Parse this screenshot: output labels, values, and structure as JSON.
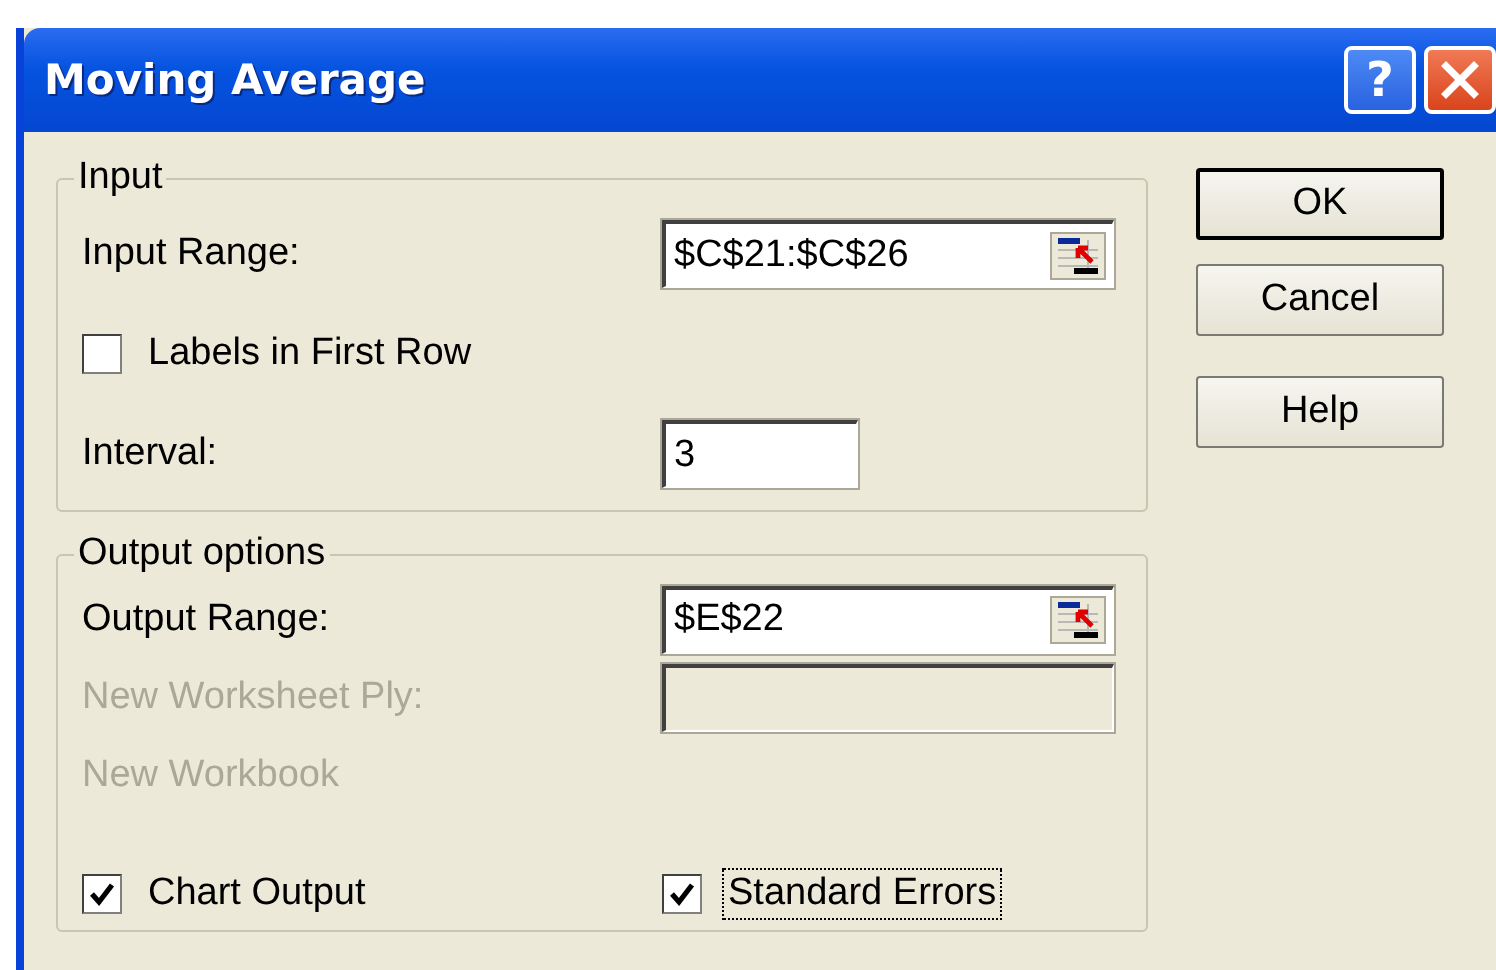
{
  "window": {
    "title": "Moving Average"
  },
  "title_buttons": [
    {
      "kind": "help",
      "label": "?"
    },
    {
      "kind": "close"
    }
  ],
  "input": {
    "legend": "Input",
    "rows": [
      {
        "kind": "range",
        "label": "Input Range:",
        "value": "$C$21:$C$26",
        "disabled": false
      },
      {
        "kind": "checkbox",
        "label": "Labels in First Row",
        "checked": false
      },
      {
        "kind": "text",
        "label": "Interval:",
        "value": "3",
        "disabled": false
      }
    ]
  },
  "output": {
    "legend": "Output options",
    "rows": [
      {
        "kind": "range",
        "label": "Output Range:",
        "value": "$E$22",
        "disabled": false
      },
      {
        "kind": "text",
        "label": "New Worksheet Ply:",
        "disabled": true
      },
      {
        "kind": "plain",
        "label": "New Workbook",
        "disabled": true
      },
      {
        "kind": "checkpair",
        "items": [
          {
            "label": "Chart Output",
            "checked": true,
            "focused": false
          },
          {
            "label": "Standard Errors",
            "checked": true,
            "focused": true
          }
        ]
      }
    ]
  },
  "buttons": [
    {
      "label": "OK",
      "default": true
    },
    {
      "label": "Cancel",
      "default": false
    },
    {
      "label": "Help",
      "default": false
    }
  ]
}
